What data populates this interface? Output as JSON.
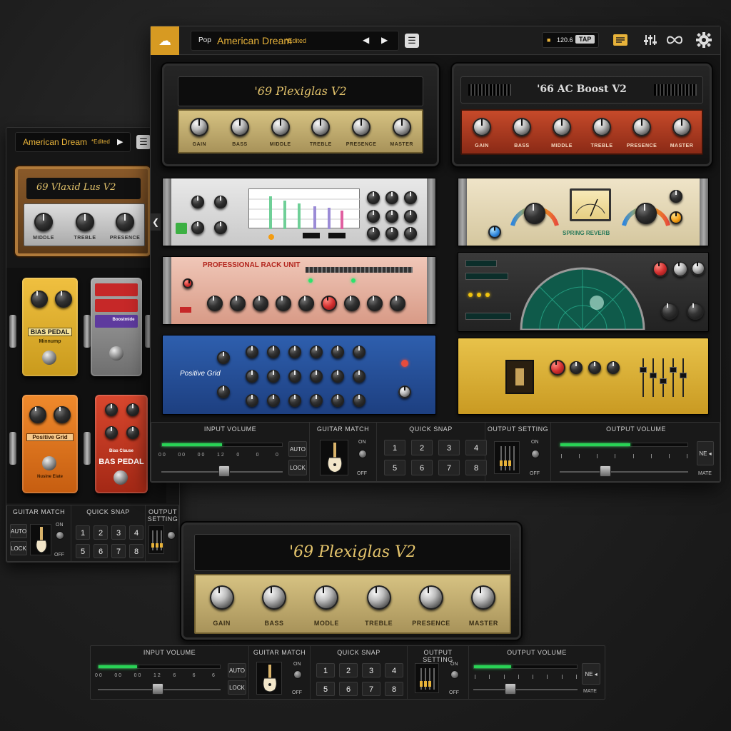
{
  "main_window": {
    "topbar": {
      "genre": "Pop",
      "preset_name": "American Dream",
      "edited_label": "*Edited",
      "prev_arrow": "◀",
      "next_arrow": "▶",
      "menu_glyph": "☰",
      "tempo_lock": "🔒",
      "tempo_bpm": "120.6",
      "tap_label": "TAP",
      "icons": [
        "logo-icon",
        "preset-list-icon",
        "mixer-icon",
        "loop-icon",
        "gear-icon"
      ]
    },
    "amp_left": {
      "name": "'69 Plexiglas V2",
      "knobs": [
        "GAIN",
        "BASS",
        "MIDDLE",
        "TREBLE",
        "PRESENCE",
        "MASTER"
      ]
    },
    "amp_right": {
      "name": "'66 AC Boost V2",
      "knobs": [
        "GAIN",
        "BASS",
        "MIDDLE",
        "TREBLE",
        "PRESENCE",
        "MASTER"
      ]
    },
    "racks": {
      "professional": {
        "title": "PROFESSIONAL RACK UNIT"
      },
      "blue": {
        "title": "Positive Grid"
      },
      "spring": {
        "title": "SPRING REVERB"
      }
    },
    "collapse_arrow": "❮",
    "bottom_bar": {
      "input_title": "INPUT VOLUME",
      "input_scale": [
        "0 0",
        "0 0",
        "0 0",
        "1 2",
        "0",
        "0",
        "0"
      ],
      "auto_label": "AUTO",
      "lock_label": "LOCK",
      "guitar_title": "GUITAR MATCH",
      "toggle_on": "ON",
      "toggle_off": "OFF",
      "snap_title": "QUICK SNAP",
      "snaps": [
        "1",
        "2",
        "3",
        "4",
        "5",
        "6",
        "7",
        "8"
      ],
      "output_setting_title": "OUTPUT SETTING",
      "output_title": "OUTPUT VOLUME",
      "mute_btn": "NE ◂",
      "mute_label": "MATE"
    }
  },
  "side_window": {
    "preset_name": "American Dream",
    "edited_label": "*Edited",
    "next_arrow": "▶",
    "menu_glyph": "☰",
    "amp": {
      "name": "69 Vlaxid Lus V2",
      "knobs": [
        "MIDDLE",
        "TREBLE",
        "PRESENCE"
      ]
    },
    "pedals": [
      {
        "name": "BIAS PEDAL",
        "sub": "Minnump"
      },
      {
        "name": "",
        "sub": "Boostmide"
      },
      {
        "name": "Positive Grid",
        "sub": "Nusine Elate"
      },
      {
        "name": "BAS PEDAL",
        "sub": "Bias Clause"
      }
    ],
    "bottom_bar": {
      "guitar_title": "GUITAR MATCH",
      "snap_title": "QUICK SNAP",
      "output_title": "OUTPUT SETTING",
      "auto_label": "AUTO",
      "lock_label": "LOCK",
      "toggle_on": "ON",
      "toggle_off": "OFF",
      "snaps": [
        "1",
        "2",
        "3",
        "4",
        "5",
        "6",
        "7",
        "8"
      ]
    }
  },
  "big_amp": {
    "name": "'69 Plexiglas V2",
    "knobs": [
      "GAIN",
      "BASS",
      "MODLE",
      "TREBLE",
      "PRESENCE",
      "MASTER"
    ]
  },
  "lower_bar": {
    "input_title": "INPUT VOLUME",
    "input_scale": [
      "0 0",
      "0 0",
      "0 0",
      "1 2",
      "6",
      "6",
      "6"
    ],
    "auto_label": "AUTO",
    "lock_label": "LOCK",
    "guitar_title": "GUITAR MATCH",
    "toggle_on": "ON",
    "toggle_off": "OFF",
    "snap_title": "QUICK SNAP",
    "snaps": [
      "1",
      "2",
      "3",
      "4",
      "5",
      "6",
      "7",
      "8"
    ],
    "output_setting_title": "OUTPUT SETTING",
    "output_title": "OUTPUT VOLUME",
    "mute_btn": "NE ◂",
    "mute_label": "MATE"
  },
  "meters": {
    "main_input_level": 0.5,
    "main_output_level": 0.55,
    "lower_input_level": 0.32,
    "lower_output_level": 0.36
  },
  "colors": {
    "accent": "#e8b33a",
    "meter_green": "#28d455",
    "amp_gold": "#d6c282",
    "amp_red": "#c74a2a"
  }
}
